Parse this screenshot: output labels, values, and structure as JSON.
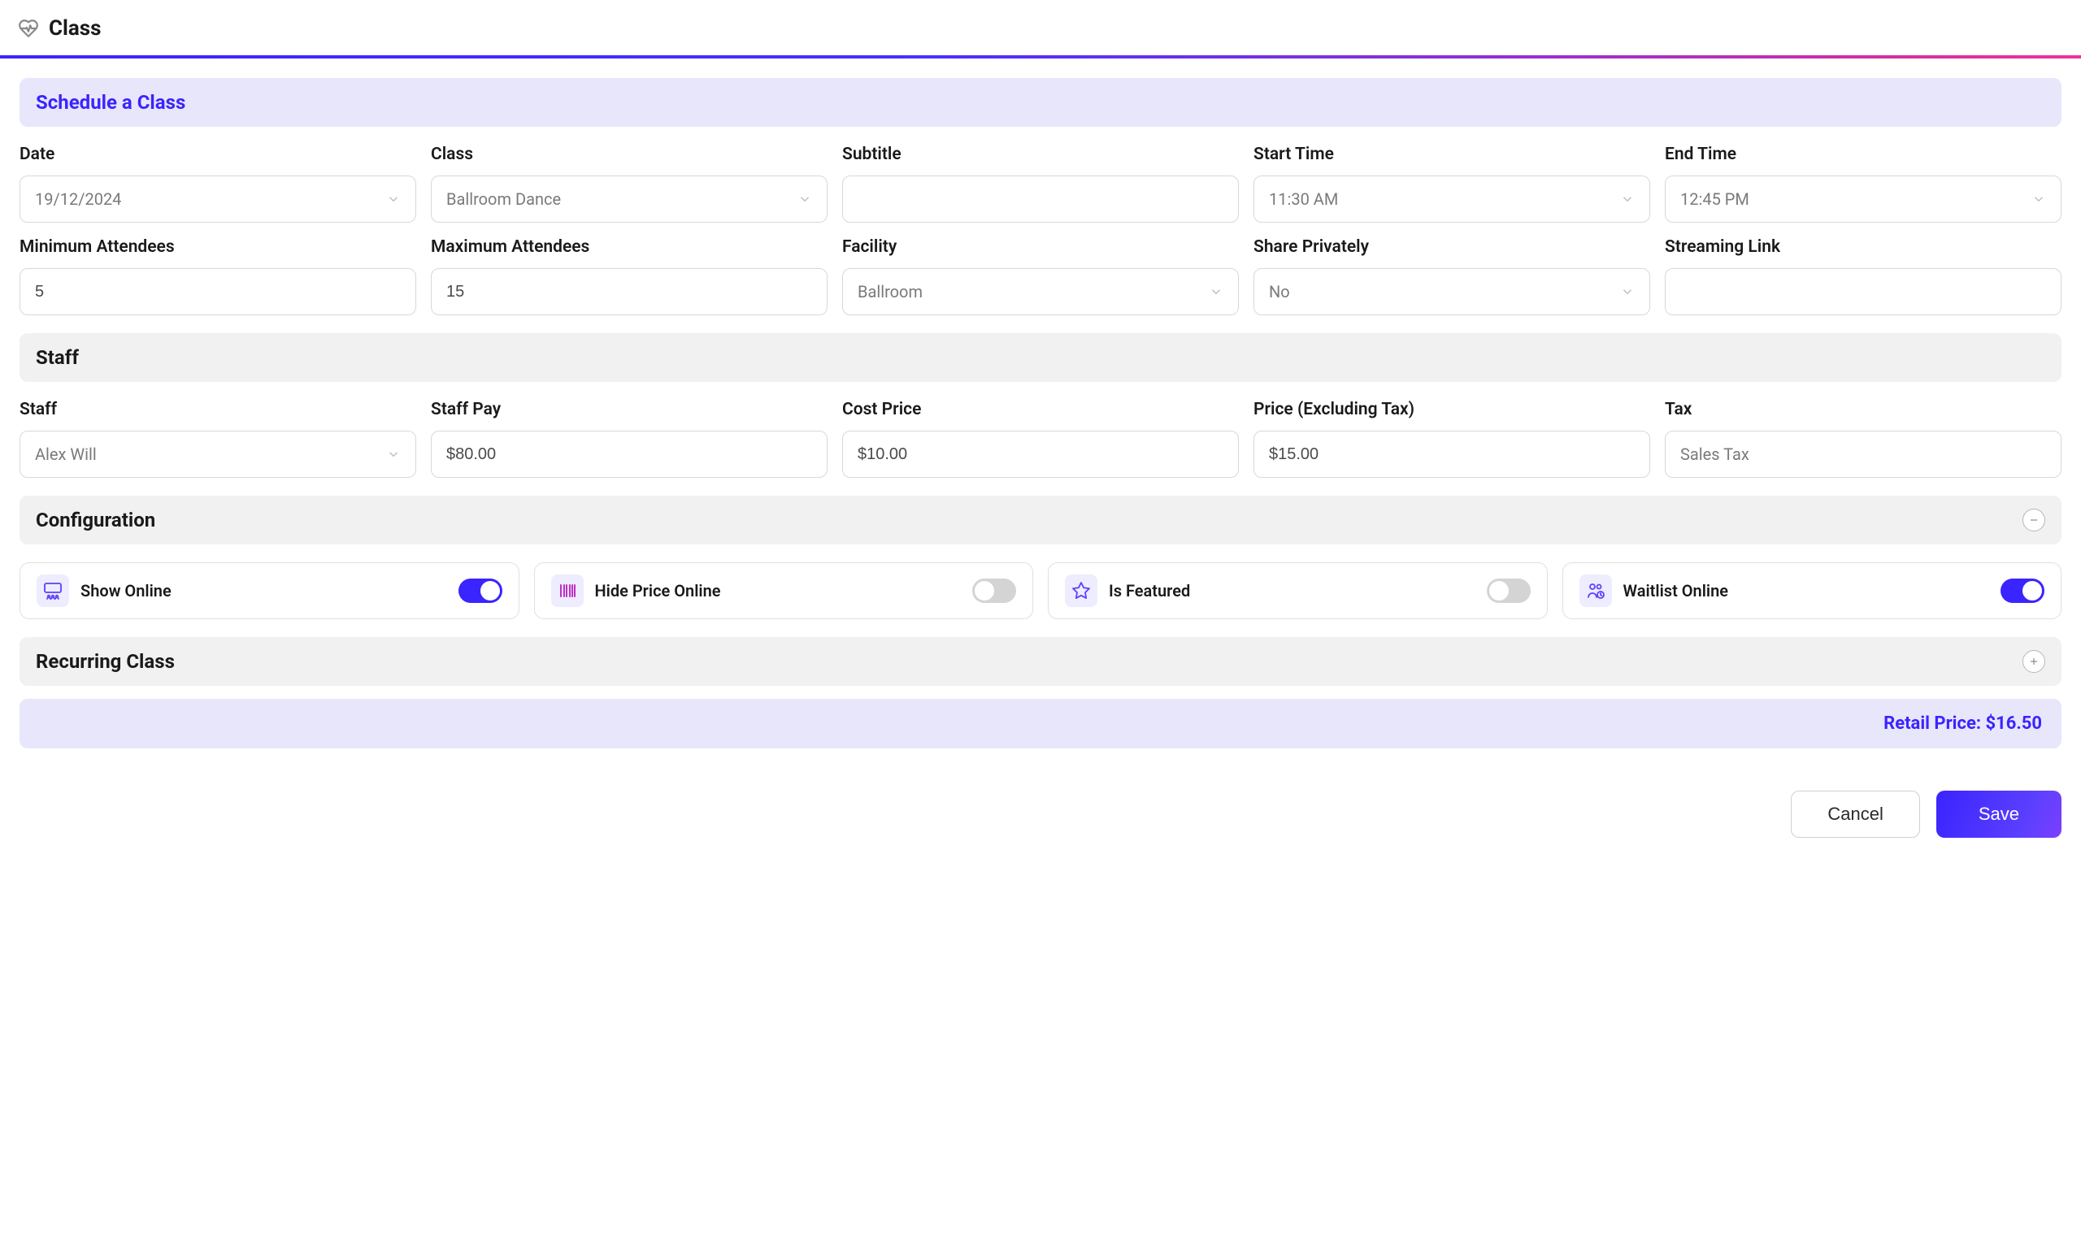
{
  "header": {
    "title": "Class"
  },
  "sections": {
    "schedule": {
      "title": "Schedule a Class"
    },
    "staff": {
      "title": "Staff"
    },
    "configuration": {
      "title": "Configuration"
    },
    "recurring": {
      "title": "Recurring Class"
    }
  },
  "form": {
    "date": {
      "label": "Date",
      "value": "19/12/2024"
    },
    "class": {
      "label": "Class",
      "value": "Ballroom Dance"
    },
    "subtitle": {
      "label": "Subtitle",
      "value": ""
    },
    "start_time": {
      "label": "Start Time",
      "value": "11:30 AM"
    },
    "end_time": {
      "label": "End Time",
      "value": "12:45 PM"
    },
    "min_attendees": {
      "label": "Minimum Attendees",
      "value": "5"
    },
    "max_attendees": {
      "label": "Maximum Attendees",
      "value": "15"
    },
    "facility": {
      "label": "Facility",
      "value": "Ballroom"
    },
    "share_privately": {
      "label": "Share Privately",
      "value": "No"
    },
    "streaming_link": {
      "label": "Streaming Link",
      "value": ""
    },
    "staff": {
      "label": "Staff",
      "value": "Alex Will"
    },
    "staff_pay": {
      "label": "Staff Pay",
      "value": "$80.00"
    },
    "cost_price": {
      "label": "Cost Price",
      "value": "$10.00"
    },
    "price_ex_tax": {
      "label": "Price (Excluding Tax)",
      "value": "$15.00"
    },
    "tax": {
      "label": "Tax",
      "value": "Sales Tax"
    }
  },
  "toggles": {
    "show_online": {
      "label": "Show Online",
      "on": true,
      "icon": "display-people-icon"
    },
    "hide_price": {
      "label": "Hide Price Online",
      "on": false,
      "icon": "barcode-icon"
    },
    "is_featured": {
      "label": "Is Featured",
      "on": false,
      "icon": "star-icon"
    },
    "waitlist": {
      "label": "Waitlist Online",
      "on": true,
      "icon": "people-clock-icon"
    }
  },
  "retail": {
    "label": "Retail Price:",
    "value": "$16.50"
  },
  "actions": {
    "cancel": "Cancel",
    "save": "Save"
  }
}
